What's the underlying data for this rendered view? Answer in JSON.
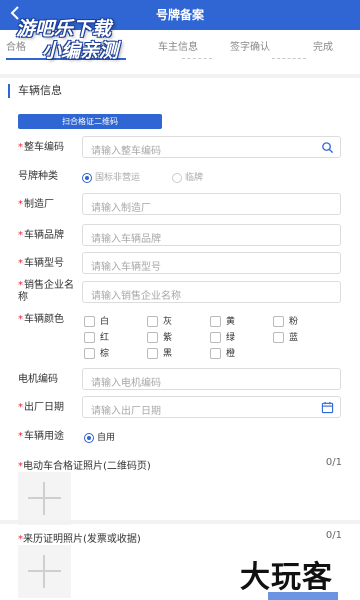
{
  "header": {
    "title": "号牌备案"
  },
  "watermark": {
    "line1": "游吧乐下载",
    "line2": "小编亲测"
  },
  "steps": [
    "合格",
    "信息",
    "车主信息",
    "签字确认",
    "完成"
  ],
  "section": {
    "title": "车辆信息"
  },
  "scan_button": "扫合格证二维码",
  "fields": {
    "vin": {
      "label": "整车编码",
      "placeholder": "请输入整车编码"
    },
    "plate_type": {
      "label": "号牌种类",
      "options": [
        "国标非营运",
        "临牌"
      ],
      "selected": "国标非营运"
    },
    "manufacturer": {
      "label": "制造厂",
      "placeholder": "请输入制造厂"
    },
    "brand": {
      "label": "车辆品牌",
      "placeholder": "请输入车辆品牌"
    },
    "model": {
      "label": "车辆型号",
      "placeholder": "请输入车辆型号"
    },
    "seller": {
      "label_line1": "销售企业名",
      "label_line2": "称",
      "placeholder": "请输入销售企业名称"
    },
    "color": {
      "label": "车辆颜色",
      "options": [
        "白",
        "灰",
        "黄",
        "粉",
        "红",
        "紫",
        "绿",
        "蓝",
        "棕",
        "黑",
        "橙"
      ]
    },
    "motor": {
      "label": "电机编码",
      "placeholder": "请输入电机编码"
    },
    "date": {
      "label": "出厂日期",
      "placeholder": "请输入出厂日期"
    },
    "usage": {
      "label": "车辆用途",
      "option": "自用"
    }
  },
  "uploads": [
    {
      "title": "电动车合格证照片(二维码页)",
      "count": "0/1"
    },
    {
      "title": "来历证明照片(发票或收据)",
      "count": "0/1"
    }
  ],
  "corner_logo": "大玩客",
  "colors": {
    "primary": "#2f66d3",
    "required": "#e22233"
  }
}
